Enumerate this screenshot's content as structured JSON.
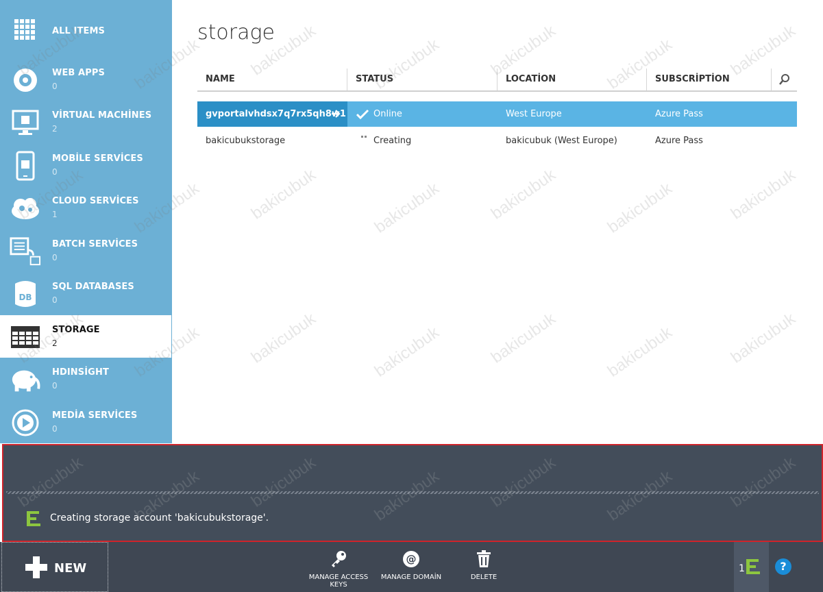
{
  "sidebar": {
    "items": [
      {
        "label": "ALL ITEMS",
        "count": "",
        "icon": "grid-icon"
      },
      {
        "label": "WEB APPS",
        "count": "0",
        "icon": "globe-icon"
      },
      {
        "label": "VİRTUAL MACHİNES",
        "count": "2",
        "icon": "monitor-icon"
      },
      {
        "label": "MOBİLE SERVİCES",
        "count": "0",
        "icon": "mobile-icon"
      },
      {
        "label": "CLOUD SERVİCES",
        "count": "1",
        "icon": "cloud-gear-icon"
      },
      {
        "label": "BATCH SERVİCES",
        "count": "0",
        "icon": "batch-icon"
      },
      {
        "label": "SQL DATABASES",
        "count": "0",
        "icon": "database-icon"
      },
      {
        "label": "STORAGE",
        "count": "2",
        "icon": "storage-table-icon"
      },
      {
        "label": "HDINSİGHT",
        "count": "0",
        "icon": "elephant-icon"
      },
      {
        "label": "MEDİA SERVİCES",
        "count": "0",
        "icon": "media-play-icon"
      }
    ],
    "active_index": 7
  },
  "main": {
    "title": "storage",
    "columns": [
      "NAME",
      "STATUS",
      "LOCATİON",
      "SUBSCRİPTİON"
    ],
    "rows": [
      {
        "name": "gvportalvhdsx7q7rx5qh8w1",
        "status": "Online",
        "location": "West Europe",
        "subscription": "Azure Pass",
        "selected": true
      },
      {
        "name": "bakicubukstorage",
        "status": "Creating",
        "location": "bakicubuk (West Europe)",
        "subscription": "Azure Pass",
        "selected": false
      }
    ]
  },
  "notification": {
    "message": "Creating storage account 'bakicubukstorage'."
  },
  "commandbar": {
    "new_label": "NEW",
    "manage_keys_label": "MANAGE ACCESS KEYS",
    "manage_domain_label": "MANAGE DOMAİN",
    "delete_label": "DELETE",
    "activity_count": "1",
    "help_label": "?"
  },
  "watermark": "bakicubuk",
  "colors": {
    "sidebar": "#6cb0d5",
    "selected_row": "#5ab4e4",
    "notification_bg": "#434d5a",
    "notification_border": "#d0232a",
    "commandbar": "#3f4753",
    "accent_green": "#8dc63f",
    "help_blue": "#1a8dd8"
  }
}
